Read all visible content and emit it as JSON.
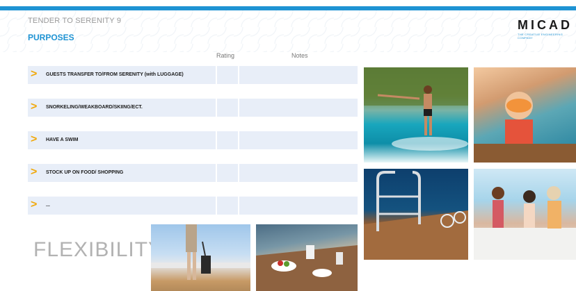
{
  "header": {
    "doc_title": "TENDER TO SERENITY 9",
    "section_title": "PURPOSES",
    "logo_text": "MICAD",
    "logo_sub": "THE CREATIVE ENGINEERING COMPANY"
  },
  "table": {
    "col_rating": "Rating",
    "col_notes": "Notes",
    "rows": [
      {
        "label": "GUESTS TRANSFER TO/FROM SERENITY (with LUGGAGE)"
      },
      {
        "label": "SNORKELING/WEAKBOARD/SKIING/ECT."
      },
      {
        "label": "HAVE A SWIM"
      },
      {
        "label": "STOCK UP ON FOOD/ SHOPPING"
      },
      {
        "label": "..."
      }
    ]
  },
  "flexibility": "FLEXIBILITY",
  "colors": {
    "accent_blue": "#1f93d3",
    "chevron_orange": "#f0a80a",
    "row_bg": "#e8eef8"
  },
  "icons": {
    "chevron": "chevron-right-icon"
  }
}
